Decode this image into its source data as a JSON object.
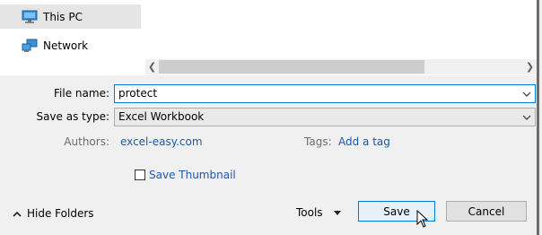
{
  "nav": {
    "items": [
      {
        "label": "This PC",
        "icon": "computer-icon",
        "selected": true
      },
      {
        "label": "Network",
        "icon": "network-icon",
        "selected": false
      }
    ]
  },
  "form": {
    "filename_label": "File name:",
    "filename_value": "protect",
    "savetype_label": "Save as type:",
    "savetype_value": "Excel Workbook",
    "authors_label": "Authors:",
    "authors_value": "excel-easy.com",
    "tags_label": "Tags:",
    "tags_value": "Add a tag",
    "thumbnail_label": "Save Thumbnail",
    "thumbnail_checked": false
  },
  "footer": {
    "hide_folders_label": "Hide Folders",
    "tools_label": "Tools",
    "save_label": "Save",
    "cancel_label": "Cancel"
  },
  "colors": {
    "accent": "#0078d7",
    "link": "#1e5aa8",
    "selected_bg": "#e5e5e5"
  }
}
